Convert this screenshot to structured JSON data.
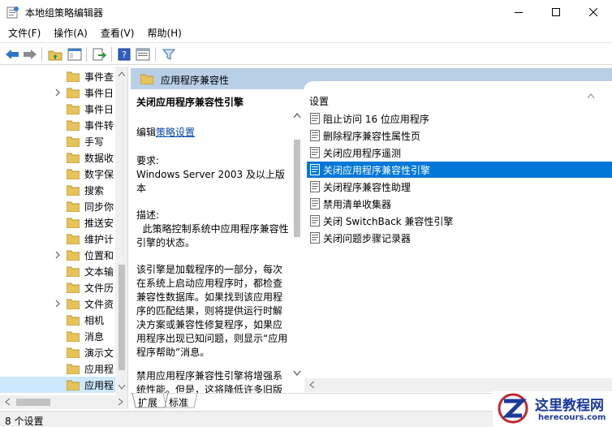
{
  "window": {
    "title": "本地组策略编辑器"
  },
  "menu": [
    {
      "label": "文件(F)"
    },
    {
      "label": "操作(A)"
    },
    {
      "label": "查看(V)"
    },
    {
      "label": "帮助(H)"
    }
  ],
  "tree": {
    "items": [
      {
        "label": "事件查",
        "expandable": false
      },
      {
        "label": "事件日",
        "expandable": true
      },
      {
        "label": "事件日",
        "expandable": false
      },
      {
        "label": "事件转",
        "expandable": false
      },
      {
        "label": "手写",
        "expandable": false
      },
      {
        "label": "数据收",
        "expandable": false
      },
      {
        "label": "数字保",
        "expandable": false
      },
      {
        "label": "搜索",
        "expandable": false
      },
      {
        "label": "同步你",
        "expandable": false
      },
      {
        "label": "推送安",
        "expandable": false
      },
      {
        "label": "维护计",
        "expandable": false
      },
      {
        "label": "位置和",
        "expandable": true
      },
      {
        "label": "文本输",
        "expandable": false
      },
      {
        "label": "文件历",
        "expandable": false
      },
      {
        "label": "文件资",
        "expandable": true
      },
      {
        "label": "相机",
        "expandable": false
      },
      {
        "label": "消息",
        "expandable": false
      },
      {
        "label": "演示文",
        "expandable": false
      },
      {
        "label": "应用程",
        "expandable": false
      },
      {
        "label": "应用程",
        "expandable": false,
        "selected": true
      }
    ]
  },
  "header": {
    "title": "应用程序兼容性"
  },
  "description": {
    "title": "关闭应用程序兼容性引擎",
    "edit_prefix": "编辑",
    "edit_link": "策略设置",
    "requirements_label": "要求:",
    "requirements_value": "Windows Server 2003 及以上版本",
    "desc_label": "描述:",
    "desc_text": "此策略控制系统中应用程序兼容性引擎的状态。",
    "para1": "该引擎是加载程序的一部分，每次在系统上启动应用程序时，都检查兼容性数据库。如果找到该应用程序的匹配结果，则将提供运行时解决方案或兼容性修复程序，如果应用程序出现已知问题，则显示“应用程序帮助”消息。",
    "para2": "禁用应用程序兼容性引擎将增强系统性能。但是，这将降低许多旧版"
  },
  "list": {
    "column_header": "设置",
    "items": [
      {
        "label": "阻止访问 16 位应用程序"
      },
      {
        "label": "删除程序兼容性属性页"
      },
      {
        "label": "关闭应用程序遥测"
      },
      {
        "label": "关闭应用程序兼容性引擎",
        "selected": true
      },
      {
        "label": "关闭程序兼容性助理"
      },
      {
        "label": "禁用清单收集器"
      },
      {
        "label": "关闭 SwitchBack 兼容性引擎"
      },
      {
        "label": "关闭问题步骤记录器"
      }
    ]
  },
  "tabs": [
    {
      "label": "扩展"
    },
    {
      "label": "标准"
    }
  ],
  "status": {
    "text": "8 个设置"
  },
  "watermark": {
    "title": "这里教程网",
    "url": "herecours.com"
  },
  "colors": {
    "selection": "#0078d7",
    "header_bar": "#b9cfe6",
    "folder": "#e8c35a",
    "link": "#0645ad"
  }
}
